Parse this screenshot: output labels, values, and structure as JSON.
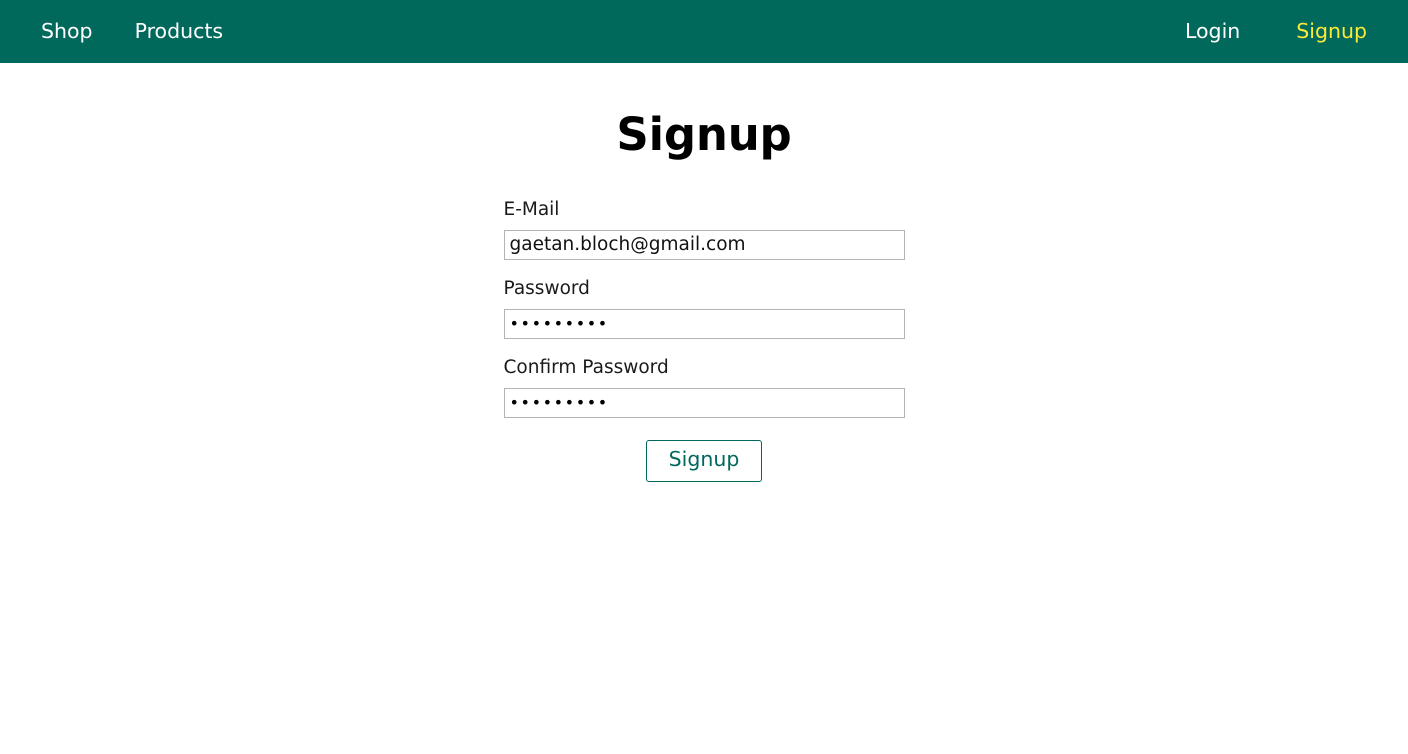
{
  "header": {
    "nav_left": [
      {
        "label": "Shop",
        "active": false
      },
      {
        "label": "Products",
        "active": false
      }
    ],
    "nav_right": [
      {
        "label": "Login",
        "active": false
      },
      {
        "label": "Signup",
        "active": true
      }
    ],
    "background_color": "#00695c",
    "link_color": "#ffffff",
    "active_link_color": "#faeb36"
  },
  "main": {
    "title": "Signup",
    "form": {
      "fields": [
        {
          "label": "E-Mail",
          "type": "email",
          "value": "gaetan.bloch@gmail.com",
          "placeholder": ""
        },
        {
          "label": "Password",
          "type": "password",
          "value": "•••••••••",
          "placeholder": ""
        },
        {
          "label": "Confirm Password",
          "type": "password",
          "value": "•••••••••",
          "placeholder": ""
        }
      ],
      "submit_label": "Signup",
      "submit_color": "#00695c"
    }
  }
}
